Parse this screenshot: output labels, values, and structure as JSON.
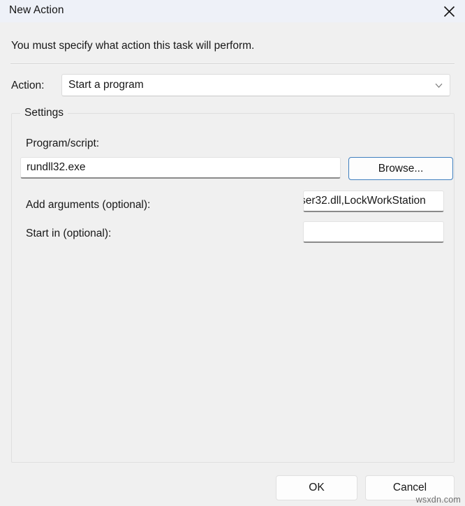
{
  "window": {
    "title": "New Action",
    "close_icon": "close-icon"
  },
  "description": "You must specify what action this task will perform.",
  "action_row": {
    "label": "Action:",
    "selected_value": "Start a program",
    "dropdown_icon": "chevron-down-icon"
  },
  "settings": {
    "group_title": "Settings",
    "program": {
      "label": "Program/script:",
      "value": "rundll32.exe",
      "placeholder": ""
    },
    "browse_button": "Browse...",
    "arguments": {
      "label": "Add arguments (optional):",
      "value": "ser32.dll,LockWorkStation",
      "placeholder": ""
    },
    "start_in": {
      "label": "Start in (optional):",
      "value": "",
      "placeholder": ""
    }
  },
  "footer": {
    "ok_label": "OK",
    "cancel_label": "Cancel"
  },
  "watermark": "wsxdn.com",
  "colors": {
    "titlebar_bg": "#eef1f8",
    "body_bg": "#f0f0f0",
    "accent_border": "#3f7fbf",
    "input_underline": "#8a8a8a",
    "text": "#171717"
  }
}
